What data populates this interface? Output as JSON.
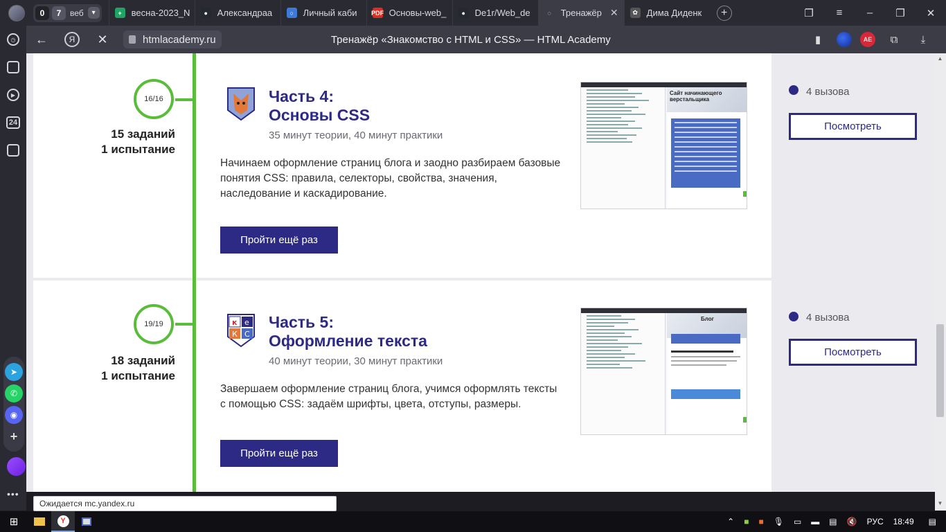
{
  "browser": {
    "counters": {
      "first": "0",
      "second": "7",
      "label": "веб"
    },
    "tabs": [
      {
        "title": "весна-2023_N",
        "color": "#21a366",
        "glyph": "+"
      },
      {
        "title": "Александраа",
        "color": "#24292f",
        "glyph": "●"
      },
      {
        "title": "Личный каби",
        "color": "#3d7bd9",
        "glyph": "○"
      },
      {
        "title": "Основы-web_",
        "color": "#d93025",
        "glyph": "PDF"
      },
      {
        "title": "De1r/Web_de",
        "color": "#24292f",
        "glyph": "●"
      },
      {
        "title": "Тренажёр",
        "color": "#3c3c47",
        "glyph": "◌",
        "active": true
      },
      {
        "title": "Дима Диденк",
        "color": "#555",
        "glyph": "✿"
      }
    ],
    "url": "htmlacademy.ru",
    "page_title": "Тренажёр «Знакомство с HTML и CSS» — HTML Academy",
    "ya_label": "Я",
    "ext_badge": "AE",
    "status_tip": "Ожидается mc.yandex.ru"
  },
  "sidepanel": {
    "badge_24": "24"
  },
  "parts": [
    {
      "progress": "16/16",
      "tasks_line1": "15 заданий",
      "tasks_line2": "1 испытание",
      "title_line1": "Часть 4:",
      "title_line2": "Основы CSS",
      "meta": "35 минут теории, 40 минут практики",
      "description": "Начинаем оформление страниц блога и заодно разбираем базовые понятия CSS: правила, селекторы, свойства, значения, наследование и каскадирование.",
      "button": "Пройти ещё раз",
      "challenges": "4 вызова",
      "view_button": "Посмотреть",
      "preview_heading": "Сайт начинающего верстальщика"
    },
    {
      "progress": "19/19",
      "tasks_line1": "18 заданий",
      "tasks_line2": "1 испытание",
      "title_line1": "Часть 5:",
      "title_line2": "Оформление текста",
      "meta": "40 минут теории, 30 минут практики",
      "description": "Завершаем оформление страниц блога, учимся оформлять тексты с помощью CSS: задаём шрифты, цвета, отступы, размеры.",
      "button": "Пройти ещё раз",
      "challenges": "4 вызова",
      "view_button": "Посмотреть",
      "preview_heading": "Блог"
    }
  ],
  "taskbar": {
    "lang": "РУС",
    "time": "18:49"
  }
}
